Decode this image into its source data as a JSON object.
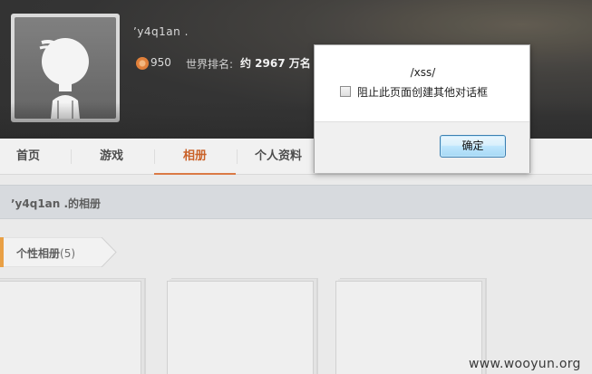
{
  "profile": {
    "username": "ʼy4q1an .",
    "coins": "950",
    "rank_label": "世界排名:",
    "rank_value": "约 2967 万名"
  },
  "nav": {
    "items": [
      {
        "label": "首页"
      },
      {
        "label": "游戏"
      },
      {
        "label": "相册",
        "active": true
      },
      {
        "label": "个人资料"
      }
    ]
  },
  "album_page": {
    "title": "ʼy4q1an .的相册",
    "category_label": "个性相册",
    "category_count": "(5)"
  },
  "dialog": {
    "message": "/xss/",
    "checkbox_label": "阻止此页面创建其他对话框",
    "ok_label": "确定"
  },
  "watermark": "www.wooyun.org",
  "colors": {
    "accent": "#d9733c",
    "header_bg": "#2a2a2a",
    "ok_border": "#3c7fb1"
  }
}
